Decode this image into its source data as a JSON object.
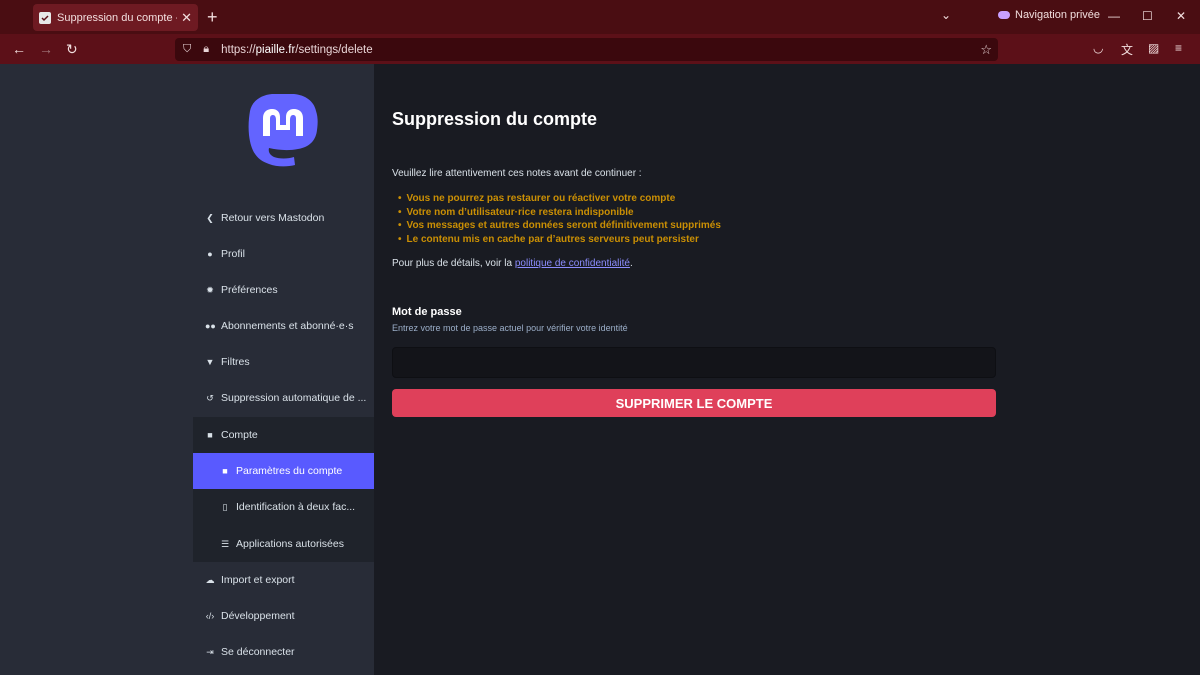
{
  "browser": {
    "tab_title": "Suppression du compte - Piaille",
    "private_label": "Navigation privée",
    "url_prefix": "https://",
    "url_host": "piaille.fr",
    "url_path": "/settings/delete"
  },
  "sidebar": {
    "items": [
      {
        "label": "Retour vers Mastodon",
        "icon": "chevron-left-icon"
      },
      {
        "label": "Profil",
        "icon": "user-icon"
      },
      {
        "label": "Préférences",
        "icon": "cog-icon"
      },
      {
        "label": "Abonnements et abonné·e·s",
        "icon": "users-icon"
      },
      {
        "label": "Filtres",
        "icon": "filter-icon"
      },
      {
        "label": "Suppression automatique de ...",
        "icon": "history-icon"
      },
      {
        "label": "Compte",
        "icon": "lock-icon"
      },
      {
        "label": "Paramètres du compte",
        "icon": "lock-icon"
      },
      {
        "label": "Identification à deux fac...",
        "icon": "mobile-icon"
      },
      {
        "label": "Applications autorisées",
        "icon": "list-icon"
      },
      {
        "label": "Import et export",
        "icon": "cloud-download-icon"
      },
      {
        "label": "Développement",
        "icon": "code-icon"
      },
      {
        "label": "Se déconnecter",
        "icon": "sign-out-icon"
      }
    ]
  },
  "main": {
    "title": "Suppression du compte",
    "intro": "Veuillez lire attentivement ces notes avant de continuer :",
    "warnings": [
      "Vous ne pourrez pas restaurer ou réactiver votre compte",
      "Votre nom d’utilisateur·rice restera indisponible",
      "Vos messages et autres données seront définitivement supprimés",
      "Le contenu mis en cache par d’autres serveurs peut persister"
    ],
    "details_prefix": "Pour plus de détails, voir la ",
    "details_link": "politique de confidentialité",
    "details_suffix": ".",
    "password_label": "Mot de passe",
    "password_hint": "Entrez votre mot de passe actuel pour vérifier votre identité",
    "password_value": "",
    "delete_button": "SUPPRIMER LE COMPTE"
  },
  "colors": {
    "accent": "#595aff",
    "danger": "#df405a",
    "warning": "#ca8f04",
    "browser_frame": "#5c1018"
  }
}
